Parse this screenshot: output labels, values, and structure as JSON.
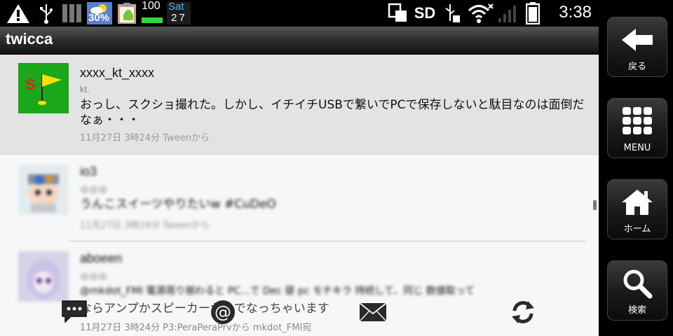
{
  "status_bar": {
    "battery_widget_percent": "30%",
    "level_widget_value": "100",
    "day": "Sat",
    "date": "27",
    "sd_label": "SD",
    "time": "3:38",
    "icons": [
      "warning-icon",
      "usb-icon",
      "signal-bars-icon",
      "weather-widget-icon",
      "clipboard-android-icon",
      "battery-widget-icon",
      "calendar-widget-icon",
      "screenshot-icon",
      "sd-icon",
      "usb-debug-icon",
      "wifi-icon",
      "no-signal-icon",
      "battery-icon"
    ]
  },
  "app": {
    "title": "twicca"
  },
  "tweets": [
    {
      "username": "xxxx_kt_xxxx",
      "display_name": "kt.",
      "text": "おっし、スクショ撮れた。しかし、イチイチUSBで繋いでPCで保存しないと駄目なのは面倒だなぁ・・・",
      "meta": "11月27日 3時24分 Tweenから",
      "selected": true
    },
    {
      "username": "io3",
      "display_name": "ゆゆゆ",
      "text": "うんこスイーツやりたいw #CuDeO",
      "meta": "11月27日 3時24分 Tweenから",
      "blurred": true
    },
    {
      "username": "aboeen",
      "display_name": "ゆゆゆ",
      "text_blurred": "@mkdot_FMI 電源周り揃わると PC...で Dec 昼 pc モチキラ 持続して、同じ 数値取って",
      "text": "ならアンプかスピーカーがこでなっちゃいます",
      "meta": "11月27日 3時24分 P3:PeraPeraPrvから mkdot_FMI宛",
      "blurred": true
    }
  ],
  "toolbar": {
    "buttons": [
      "compose-icon",
      "mention-icon",
      "message-icon",
      "refresh-icon"
    ]
  },
  "nav": {
    "back_label": "戻る",
    "menu_label": "MENU",
    "home_label": "ホーム",
    "search_label": "検索"
  },
  "colors": {
    "background": "#000000",
    "timeline_bg": "#f7f7f7",
    "selected_row": "#e3e3e3",
    "avatar_green": "#1aa81a",
    "flag_yellow": "#ffe000"
  }
}
